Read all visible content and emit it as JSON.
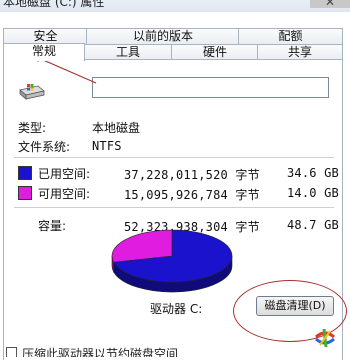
{
  "window": {
    "title": "本地磁盘 (C:) 属性",
    "close_glyph": "✕"
  },
  "tabs_top": [
    {
      "label": "安全"
    },
    {
      "label": "以前的版本"
    },
    {
      "label": "配额"
    }
  ],
  "tabs_bottom": [
    {
      "label": "常规",
      "active": true
    },
    {
      "label": "工具"
    },
    {
      "label": "硬件"
    },
    {
      "label": "共享"
    }
  ],
  "general": {
    "drive_icon": "hard-drive-icon",
    "name_value": "",
    "type_label": "类型:",
    "type_value": "本地磁盘",
    "fs_label": "文件系统:",
    "fs_value": "NTFS",
    "used": {
      "label": "已用空间:",
      "bytes": "37,228,011,520 字节",
      "size": "34.6 GB",
      "color": "#1a12cc"
    },
    "free": {
      "label": "可用空间:",
      "bytes": "15,095,926,784 字节",
      "size": "14.0 GB",
      "color": "#e01ce0"
    },
    "capacity": {
      "label": "容量:",
      "bytes": "52,323,938,304 字节",
      "size": "48.7 GB"
    },
    "drive_label": "驱动器 C:",
    "cleanup_button": "磁盘清理(D)"
  },
  "bottom_option": {
    "text": "压缩此驱动器以节约磁盘空间"
  },
  "chart_data": {
    "type": "pie",
    "categories": [
      "已用空间",
      "可用空间"
    ],
    "values": [
      34.6,
      14.0
    ],
    "colors": [
      "#1a12cc",
      "#e01ce0"
    ]
  }
}
